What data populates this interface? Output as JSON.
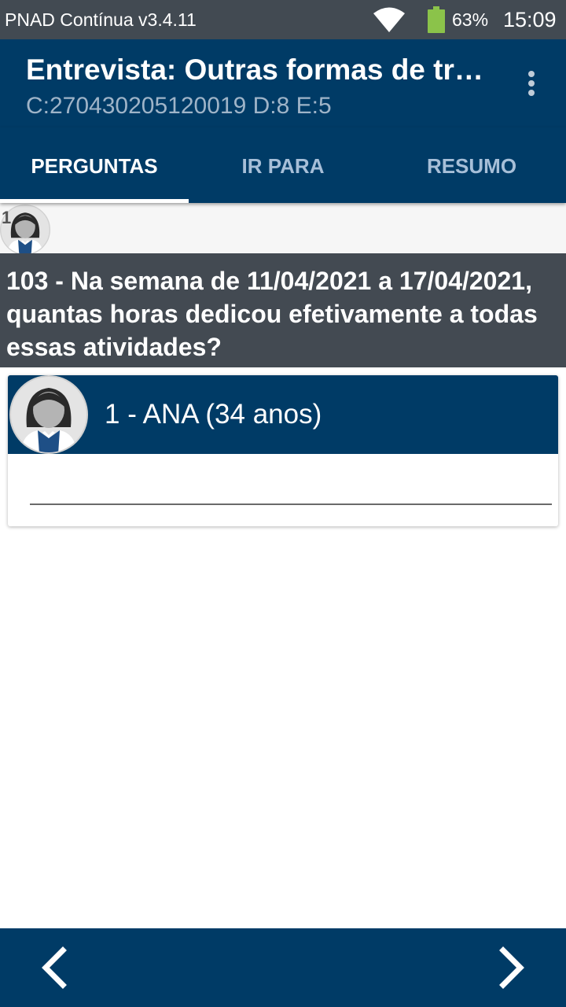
{
  "status_bar": {
    "app_name": "PNAD Contínua v3.4.11",
    "battery_percent": "63%",
    "time": "15:09",
    "icons": [
      "wifi-icon",
      "battery-icon"
    ],
    "battery_color": "#8bc34a"
  },
  "app_bar": {
    "title": "Entrevista: Outras formas de trabalho",
    "subtitle": "C:270430205120019 D:8 E:5",
    "menu_icon": "overflow-menu-icon"
  },
  "tabs": [
    {
      "label": "PERGUNTAS",
      "active": true
    },
    {
      "label": "IR PARA",
      "active": false
    },
    {
      "label": "RESUMO",
      "active": false
    }
  ],
  "person_strip": {
    "number": "1",
    "avatar_icon": "female-avatar-icon"
  },
  "question": {
    "text": "103 - Na semana de 11/04/2021 a 17/04/2021, quantas horas dedicou efetivamente a todas essas atividades?"
  },
  "answer_card": {
    "person_label": "1 - ANA (34 anos)",
    "avatar_icon": "female-avatar-icon",
    "answer_value": ""
  },
  "bottom_nav": {
    "prev_icon": "chevron-left-icon",
    "next_icon": "chevron-right-icon"
  },
  "colors": {
    "primary": "#003b66",
    "status_bar": "#424a52",
    "question_bg": "#434a52",
    "tab_inactive": "#a7bfd8"
  }
}
